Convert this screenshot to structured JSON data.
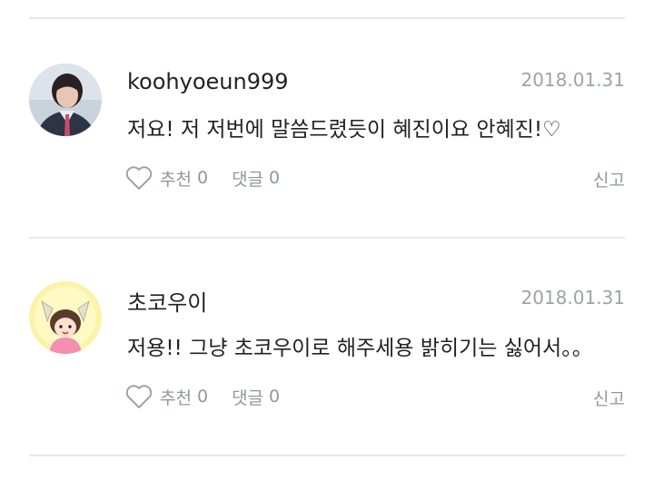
{
  "comments": [
    {
      "username": "koohyoeun999",
      "date": "2018.01.31",
      "text": "저요! 저 저번에 말씀드렸듯이 혜진이요 안혜진!♡",
      "like_label": "추천",
      "like_count": "0",
      "reply_label": "댓글",
      "reply_count": "0",
      "report_label": "신고",
      "avatar_icon": "person-photo-avatar"
    },
    {
      "username": "초코우이",
      "date": "2018.01.31",
      "text": "저용!! 그냥 초코우이로 해주세용 밝히기는 싫어서。。",
      "like_label": "추천",
      "like_count": "0",
      "reply_label": "댓글",
      "reply_count": "0",
      "report_label": "신고",
      "avatar_icon": "cartoon-girl-avatar"
    }
  ],
  "colors": {
    "divider": "#e3eaea",
    "muted_text": "#8f9999",
    "date_text": "#9aa5a5",
    "primary_text": "#222222"
  }
}
